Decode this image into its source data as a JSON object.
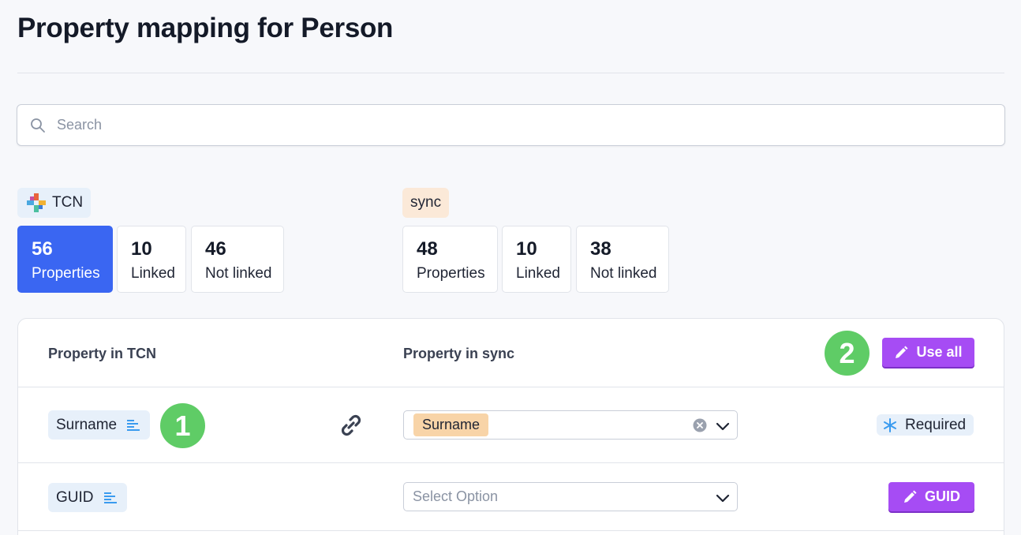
{
  "page": {
    "title": "Property mapping for Person"
  },
  "search": {
    "placeholder": "Search"
  },
  "sources": {
    "left": {
      "name": "TCN",
      "stats": [
        {
          "value": "56",
          "label": "Properties",
          "active": true
        },
        {
          "value": "10",
          "label": "Linked",
          "active": false
        },
        {
          "value": "46",
          "label": "Not linked",
          "active": false
        }
      ]
    },
    "right": {
      "name": "sync",
      "stats": [
        {
          "value": "48",
          "label": "Properties"
        },
        {
          "value": "10",
          "label": "Linked"
        },
        {
          "value": "38",
          "label": "Not linked"
        }
      ]
    }
  },
  "table": {
    "col_left": "Property in TCN",
    "col_right": "Property in sync",
    "use_all_label": "Use all",
    "badge_2": "2",
    "rows": [
      {
        "property": "Surname",
        "badge": "1",
        "selected": "Surname",
        "action": "Required"
      },
      {
        "property": "GUID",
        "placeholder": "Select Option",
        "action": "GUID"
      }
    ]
  },
  "colors": {
    "accent_blue": "#3a66f2",
    "purple_button": "#a64cf4",
    "green_badge": "#5fcc66",
    "chip_blue": "#e7f0fa",
    "chip_orange": "#f8d4a8"
  }
}
